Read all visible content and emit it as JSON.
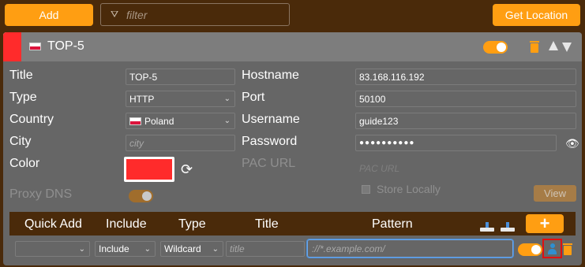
{
  "toolbar": {
    "add_label": "Add",
    "filter_placeholder": "filter",
    "get_location_label": "Get Location"
  },
  "proxy": {
    "title": "TOP-5",
    "color": "#ff2b2b",
    "fields": {
      "title_label": "Title",
      "title_value": "TOP-5",
      "type_label": "Type",
      "type_value": "HTTP",
      "country_label": "Country",
      "country_value": "Poland",
      "city_label": "City",
      "city_placeholder": "city",
      "color_label": "Color",
      "proxydns_label": "Proxy DNS",
      "hostname_label": "Hostname",
      "hostname_value": "83.168.116.192",
      "port_label": "Port",
      "port_value": "50100",
      "username_label": "Username",
      "username_value": "guide123",
      "password_label": "Password",
      "password_value": "●●●●●●●●●●",
      "pac_label": "PAC URL",
      "pac_placeholder": "PAC URL",
      "store_locally_label": "Store Locally",
      "view_label": "View"
    }
  },
  "patterns": {
    "headers": {
      "quick_add": "Quick Add",
      "include": "Include",
      "type": "Type",
      "title": "Title",
      "pattern": "Pattern"
    },
    "plus_label": "+",
    "row": {
      "quick_add_value": "",
      "include_value": "Include",
      "type_value": "Wildcard",
      "title_placeholder": "title",
      "pattern_placeholder": "://*.example.com/"
    }
  },
  "colors": {
    "accent": "#ff9e12",
    "brand_bg": "#4a2a0a",
    "card_bg": "#666666",
    "highlight": "#e01010"
  }
}
